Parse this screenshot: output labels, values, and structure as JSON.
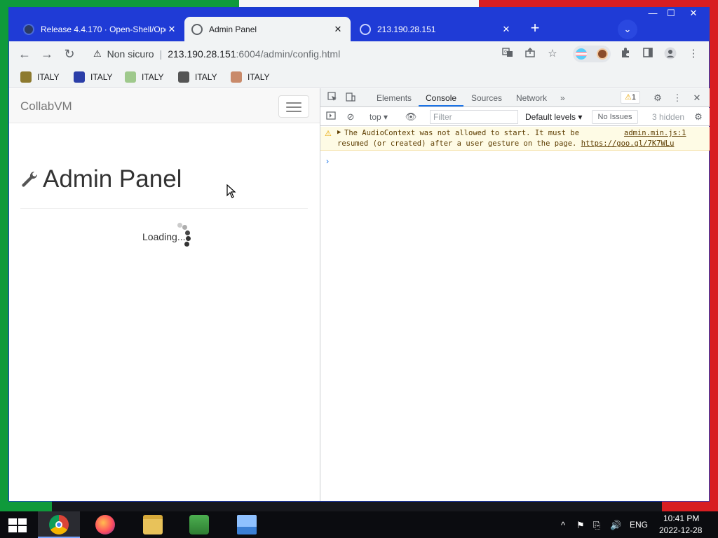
{
  "browser": {
    "tabs": [
      {
        "title": "Release 4.4.170 · Open-Shell/Ope",
        "close": "✕",
        "active": false
      },
      {
        "title": "Admin Panel",
        "close": "✕",
        "active": true
      },
      {
        "title": "213.190.28.151",
        "close": "✕",
        "active": false
      }
    ],
    "new_tab": "+",
    "tab_search": "⌄",
    "window_controls": {
      "minimize": "—",
      "maximize": "☐",
      "close": "✕"
    },
    "nav": {
      "back": "←",
      "forward": "→",
      "reload": "↻"
    },
    "omnibox": {
      "security_icon": "⚠",
      "security_label": "Non sicuro",
      "host": "213.190.28.151",
      "path": ":6004/admin/config.html"
    },
    "bookmarks": [
      {
        "label": "ITALY",
        "icon": "person-icon"
      },
      {
        "label": "ITALY",
        "icon": "x-icon"
      },
      {
        "label": "ITALY",
        "icon": "bird-icon"
      },
      {
        "label": "ITALY",
        "icon": "badge-icon"
      },
      {
        "label": "ITALY",
        "icon": "face-icon"
      }
    ]
  },
  "page": {
    "brand": "CollabVM",
    "heading": "Admin Panel",
    "loading": "Loading..."
  },
  "devtools": {
    "tabs": [
      "Elements",
      "Console",
      "Sources",
      "Network"
    ],
    "active_tab": "Console",
    "more": "»",
    "warning_count": "1",
    "context": "top",
    "filter_placeholder": "Filter",
    "levels": "Default levels ▾",
    "issues": "No Issues",
    "hidden": "3 hidden",
    "message": {
      "line1": "The AudioContext was not allowed to start. It must be",
      "line2": "resumed (or created) after a user gesture on the page.",
      "link": "https://goo.gl/7K7WLu",
      "source": "admin.min.js:1"
    },
    "prompt": "›"
  },
  "taskbar": {
    "clock_time": "10:41 PM",
    "clock_date": "2022-12-28",
    "language": "ENG",
    "tray_up": "^"
  },
  "colors": {
    "titlebar": "#1f3bd6",
    "flag_green": "#0f9a3b",
    "flag_red": "#d81e22",
    "devtools_accent": "#1a73e8",
    "warn_bg": "#fefbe5"
  }
}
